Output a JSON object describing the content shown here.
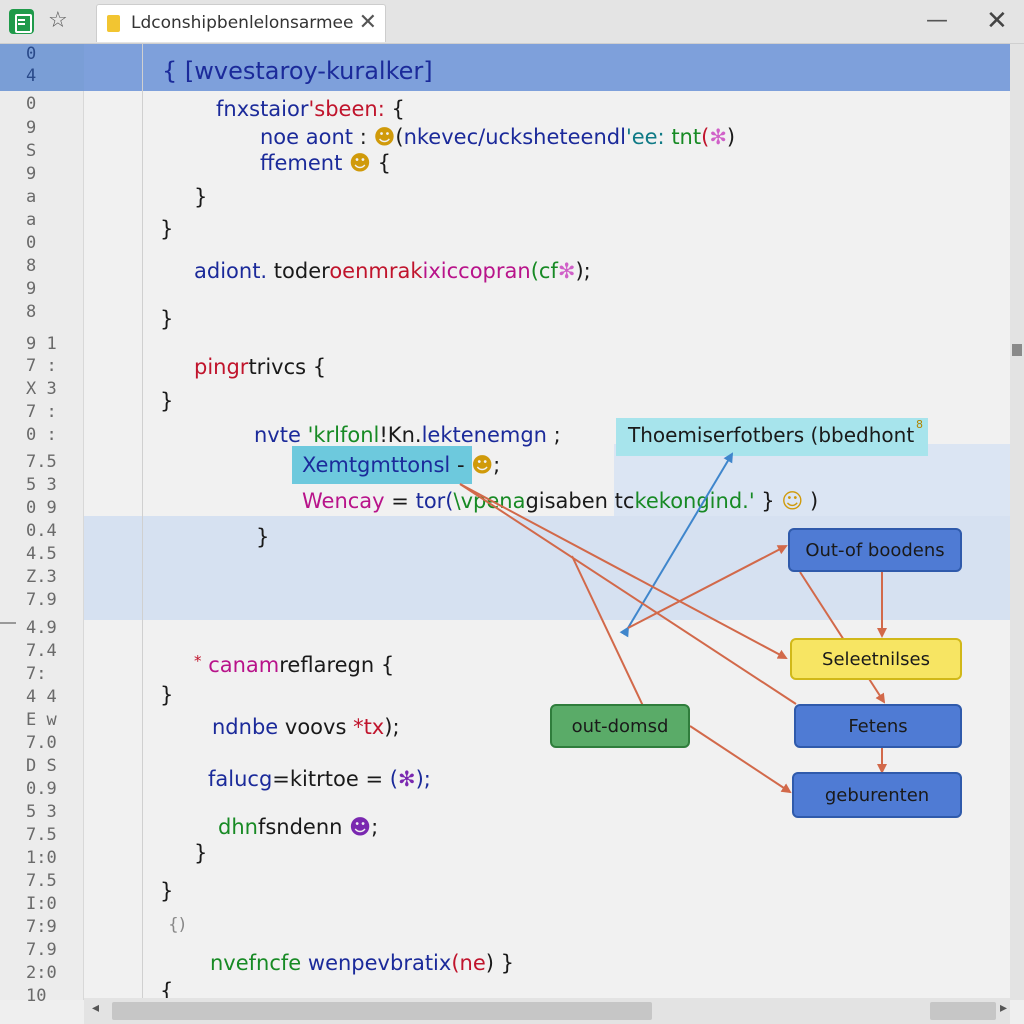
{
  "window": {
    "tab_title": "Ldconshipbenlelonsarmee",
    "app_icon": "spreadsheet-icon",
    "star_icon": "star-icon",
    "tab_close": "✕",
    "minimize": "—",
    "close": "✕"
  },
  "gutter": {
    "numbers": [
      "0",
      "4",
      "0",
      "9",
      "S",
      "9",
      "a",
      "a",
      "0",
      "8",
      "9",
      "8",
      "9 1",
      "7 :",
      "X 3",
      "7 :",
      "0 :",
      "7.5",
      "5 3",
      "0 9",
      "0.4",
      "4.5",
      "Z.3",
      "7.9",
      "4.9",
      "7.4",
      "7:",
      "4 4",
      "E w",
      "7.0",
      "D S",
      "0.9",
      "5 3",
      "7.5",
      "1:0",
      "7.5",
      "I:0",
      "7:9",
      "7.9",
      "2:0",
      "10"
    ]
  },
  "code": {
    "l1_brace": "{",
    "l1_text": "[wvestaroy-kuralker]",
    "l2_a": "fnxstaior",
    "l2_b": "'sbeen:",
    "l2_c": "{",
    "l3_a": "noe aont",
    "l3_b": ":",
    "l3_c": "(",
    "l3_d": "nkevec/ucksheteendl",
    "l3_e": "'ee:",
    "l3_f": "tnt",
    "l3_g": "(",
    "l3_h": ")",
    "l4_a": "ffement",
    "l4_b": "{",
    "l5": "}",
    "l6": "}",
    "l7_a": "adiont.",
    "l7_b": "toder",
    "l7_c": "oenmrak",
    "l7_d": "ixiccopran",
    "l7_e": "(cf",
    "l7_f": ");",
    "l8": "}",
    "l9_a": "pingr",
    "l9_b": "trivcs {",
    "l10": "}",
    "l11_a": "nvte",
    "l11_b": "'krlfonl",
    "l11_c": "!Kn.",
    "l11_d": "lektenemgn",
    "l11_e": ";",
    "l12_a": "Xemtgmttonsl",
    "l12_b": "-",
    "l12_c": ";",
    "l13_a": "Wencay",
    "l13_b": "=",
    "l13_c": "tor(",
    "l13_d": "\\vpena",
    "l13_e": "gisaben tc",
    "l13_f": "kekongind.'",
    "l13_g": "}",
    "l13_h": ")",
    "l14": "}",
    "l15_a": "*",
    "l15_b": "canam",
    "l15_c": "reflaregn {",
    "l16": "}",
    "l17_a": "ndnbe",
    "l17_b": "voovs",
    "l17_c": "*tx",
    "l17_d": ");",
    "l18_a": "falucg",
    "l18_b": "=kitrtoe",
    "l18_c": "=",
    "l18_d": "(",
    "l18_e": ");",
    "l19_a": "dhn",
    "l19_b": "fsndenn",
    "l19_c": ";",
    "l20": "}",
    "l21": "}",
    "l22": "{)",
    "l23_a": "nvefncfe",
    "l23_b": "wenpevbratix",
    "l23_c": "(ne",
    "l23_d": ")",
    "l23_e": "}",
    "l24": "{"
  },
  "hint": {
    "text": "Thoemiserfotbers (bbedhont",
    "badge": "8"
  },
  "diagram": {
    "nodes": {
      "out_of_boodens": "Out-of boodens",
      "seleetnilses": "Seleetnilses",
      "fetens": "Fetens",
      "out_domsd": "out-domsd",
      "geburenten": "geburenten"
    },
    "colors": {
      "blue": "#4f7bd4",
      "yellow": "#f7e563",
      "green": "#5aab68",
      "arrow_red": "#d2694a",
      "arrow_blue": "#3f86cc"
    }
  }
}
